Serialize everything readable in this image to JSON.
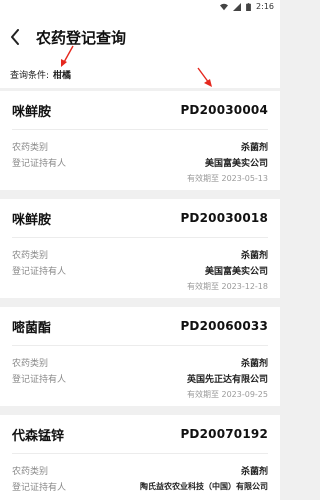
{
  "status_bar": {
    "time": "2:16"
  },
  "header": {
    "title": "农药登记查询"
  },
  "query": {
    "label": "查询条件:",
    "value": "柑橘"
  },
  "field_labels": {
    "category": "农药类别",
    "holder": "登记证持有人",
    "expiry_prefix": "有效期至"
  },
  "cards": [
    {
      "name": "咪鲜胺",
      "reg_no": "PD20030004",
      "category": "杀菌剂",
      "holder": "美国富美实公司",
      "expiry": "有效期至 2023-05-13"
    },
    {
      "name": "咪鲜胺",
      "reg_no": "PD20030018",
      "category": "杀菌剂",
      "holder": "美国富美实公司",
      "expiry": "有效期至 2023-12-18"
    },
    {
      "name": "嘧菌酯",
      "reg_no": "PD20060033",
      "category": "杀菌剂",
      "holder": "英国先正达有限公司",
      "expiry": "有效期至 2023-09-25"
    },
    {
      "name": "代森锰锌",
      "reg_no": "PD20070192",
      "category": "杀菌剂",
      "holder": "陶氏益农农业科技（中国）有限公司",
      "expiry": ""
    }
  ],
  "colors": {
    "annotation_arrow": "#e5281e",
    "label_gray": "#8a8a8a"
  }
}
